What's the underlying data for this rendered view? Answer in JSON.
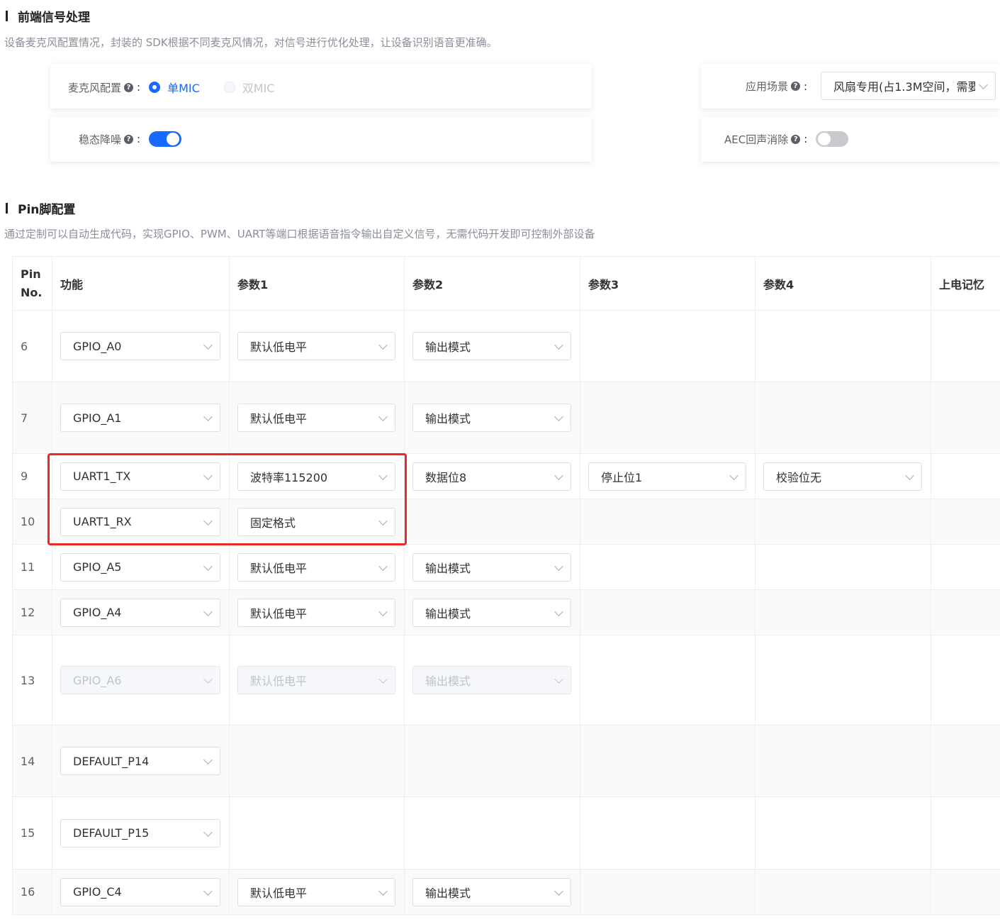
{
  "frontend": {
    "title": "前端信号处理",
    "desc": "设备麦克风配置情况，封装的 SDK根据不同麦克风情况，对信号进行优化处理，让设备识别语音更准确。",
    "mic_label": "麦克风配置",
    "mic_single": "单MIC",
    "mic_dual": "双MIC",
    "noise_label": "稳态降噪",
    "noise_on": true,
    "scene_label": "应用场景",
    "scene_value": "风扇专用(占1.3M空间，需要",
    "aec_label": "AEC回声消除",
    "aec_on": false
  },
  "pins": {
    "title": "Pin脚配置",
    "desc": "通过定制可以自动生成代码，实现GPIO、PWM、UART等端口根据语音指令输出自定义信号，无需代码开发即可控制外部设备",
    "headers": {
      "pin_line1": "Pin",
      "pin_line2": "No.",
      "func": "功能",
      "p1": "参数1",
      "p2": "参数2",
      "p3": "参数3",
      "p4": "参数4",
      "mem": "上电记忆"
    },
    "rows": [
      {
        "pin": "6",
        "func": "GPIO_A0",
        "p1": "默认低电平",
        "p2": "输出模式",
        "p3": "",
        "p4": ""
      },
      {
        "pin": "7",
        "func": "GPIO_A1",
        "p1": "默认低电平",
        "p2": "输出模式",
        "p3": "",
        "p4": ""
      },
      {
        "pin": "9",
        "func": "UART1_TX",
        "p1": "波特率115200",
        "p2": "数据位8",
        "p3": "停止位1",
        "p4": "校验位无"
      },
      {
        "pin": "10",
        "func": "UART1_RX",
        "p1": "固定格式",
        "p2": "",
        "p3": "",
        "p4": ""
      },
      {
        "pin": "11",
        "func": "GPIO_A5",
        "p1": "默认低电平",
        "p2": "输出模式",
        "p3": "",
        "p4": ""
      },
      {
        "pin": "12",
        "func": "GPIO_A4",
        "p1": "默认低电平",
        "p2": "输出模式",
        "p3": "",
        "p4": ""
      },
      {
        "pin": "13",
        "func": "GPIO_A6",
        "p1": "默认低电平",
        "p2": "输出模式",
        "p3": "",
        "p4": ""
      },
      {
        "pin": "14",
        "func": "DEFAULT_P14",
        "p1": "",
        "p2": "",
        "p3": "",
        "p4": ""
      },
      {
        "pin": "15",
        "func": "DEFAULT_P15",
        "p1": "",
        "p2": "",
        "p3": "",
        "p4": ""
      },
      {
        "pin": "16",
        "func": "GPIO_C4",
        "p1": "默认低电平",
        "p2": "输出模式",
        "p3": "",
        "p4": ""
      }
    ]
  },
  "colors": {
    "accent": "#1769ff",
    "highlight": "#ec2828"
  }
}
